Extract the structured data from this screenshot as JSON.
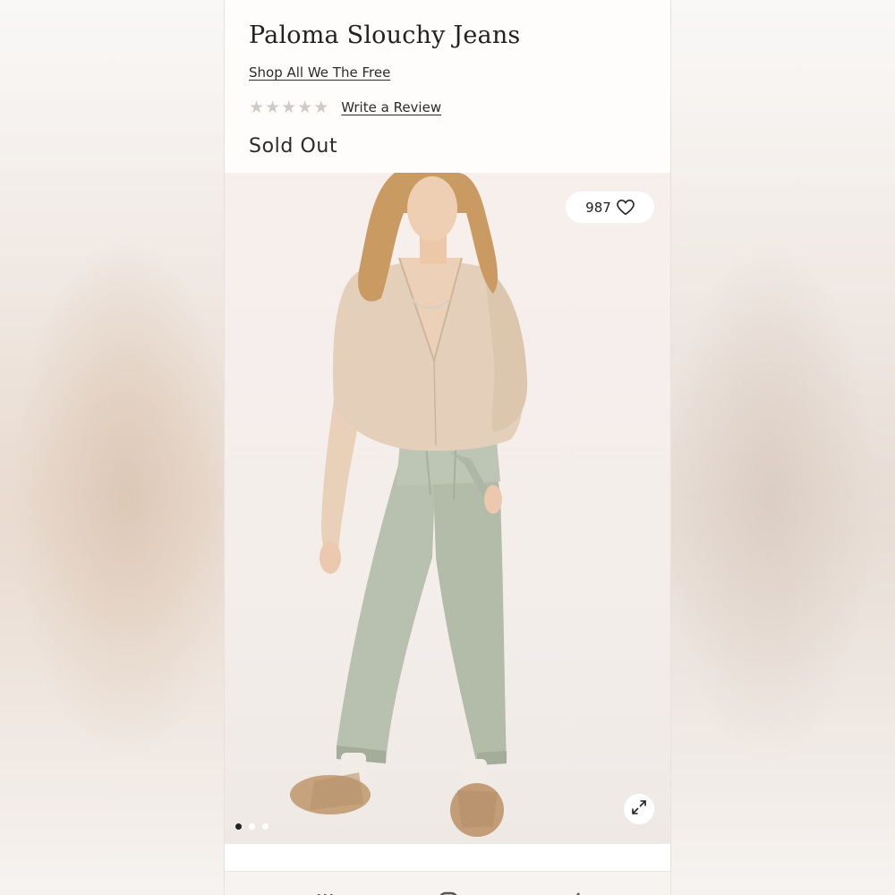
{
  "product": {
    "title": "Paloma Slouchy Jeans",
    "brand_link": "Shop All We The Free",
    "rating": {
      "stars_filled": 0,
      "stars_total": 5,
      "star_glyph": "★"
    },
    "review_link": "Write a Review",
    "availability": "Sold Out"
  },
  "gallery": {
    "likes_count": "987",
    "like_icon": "heart-outline-icon",
    "expand_icon": "expand-arrows-icon",
    "slide_count": 3,
    "active_slide": 1
  },
  "navigation": {
    "buttons": [
      "recent-apps-icon",
      "home-icon",
      "back-icon"
    ]
  },
  "colors": {
    "text": "#222222",
    "star_empty": "#cfcac6",
    "pants": "#b9c1b0",
    "sweater": "#e3cfb8",
    "shoes": "#c7a37f"
  }
}
